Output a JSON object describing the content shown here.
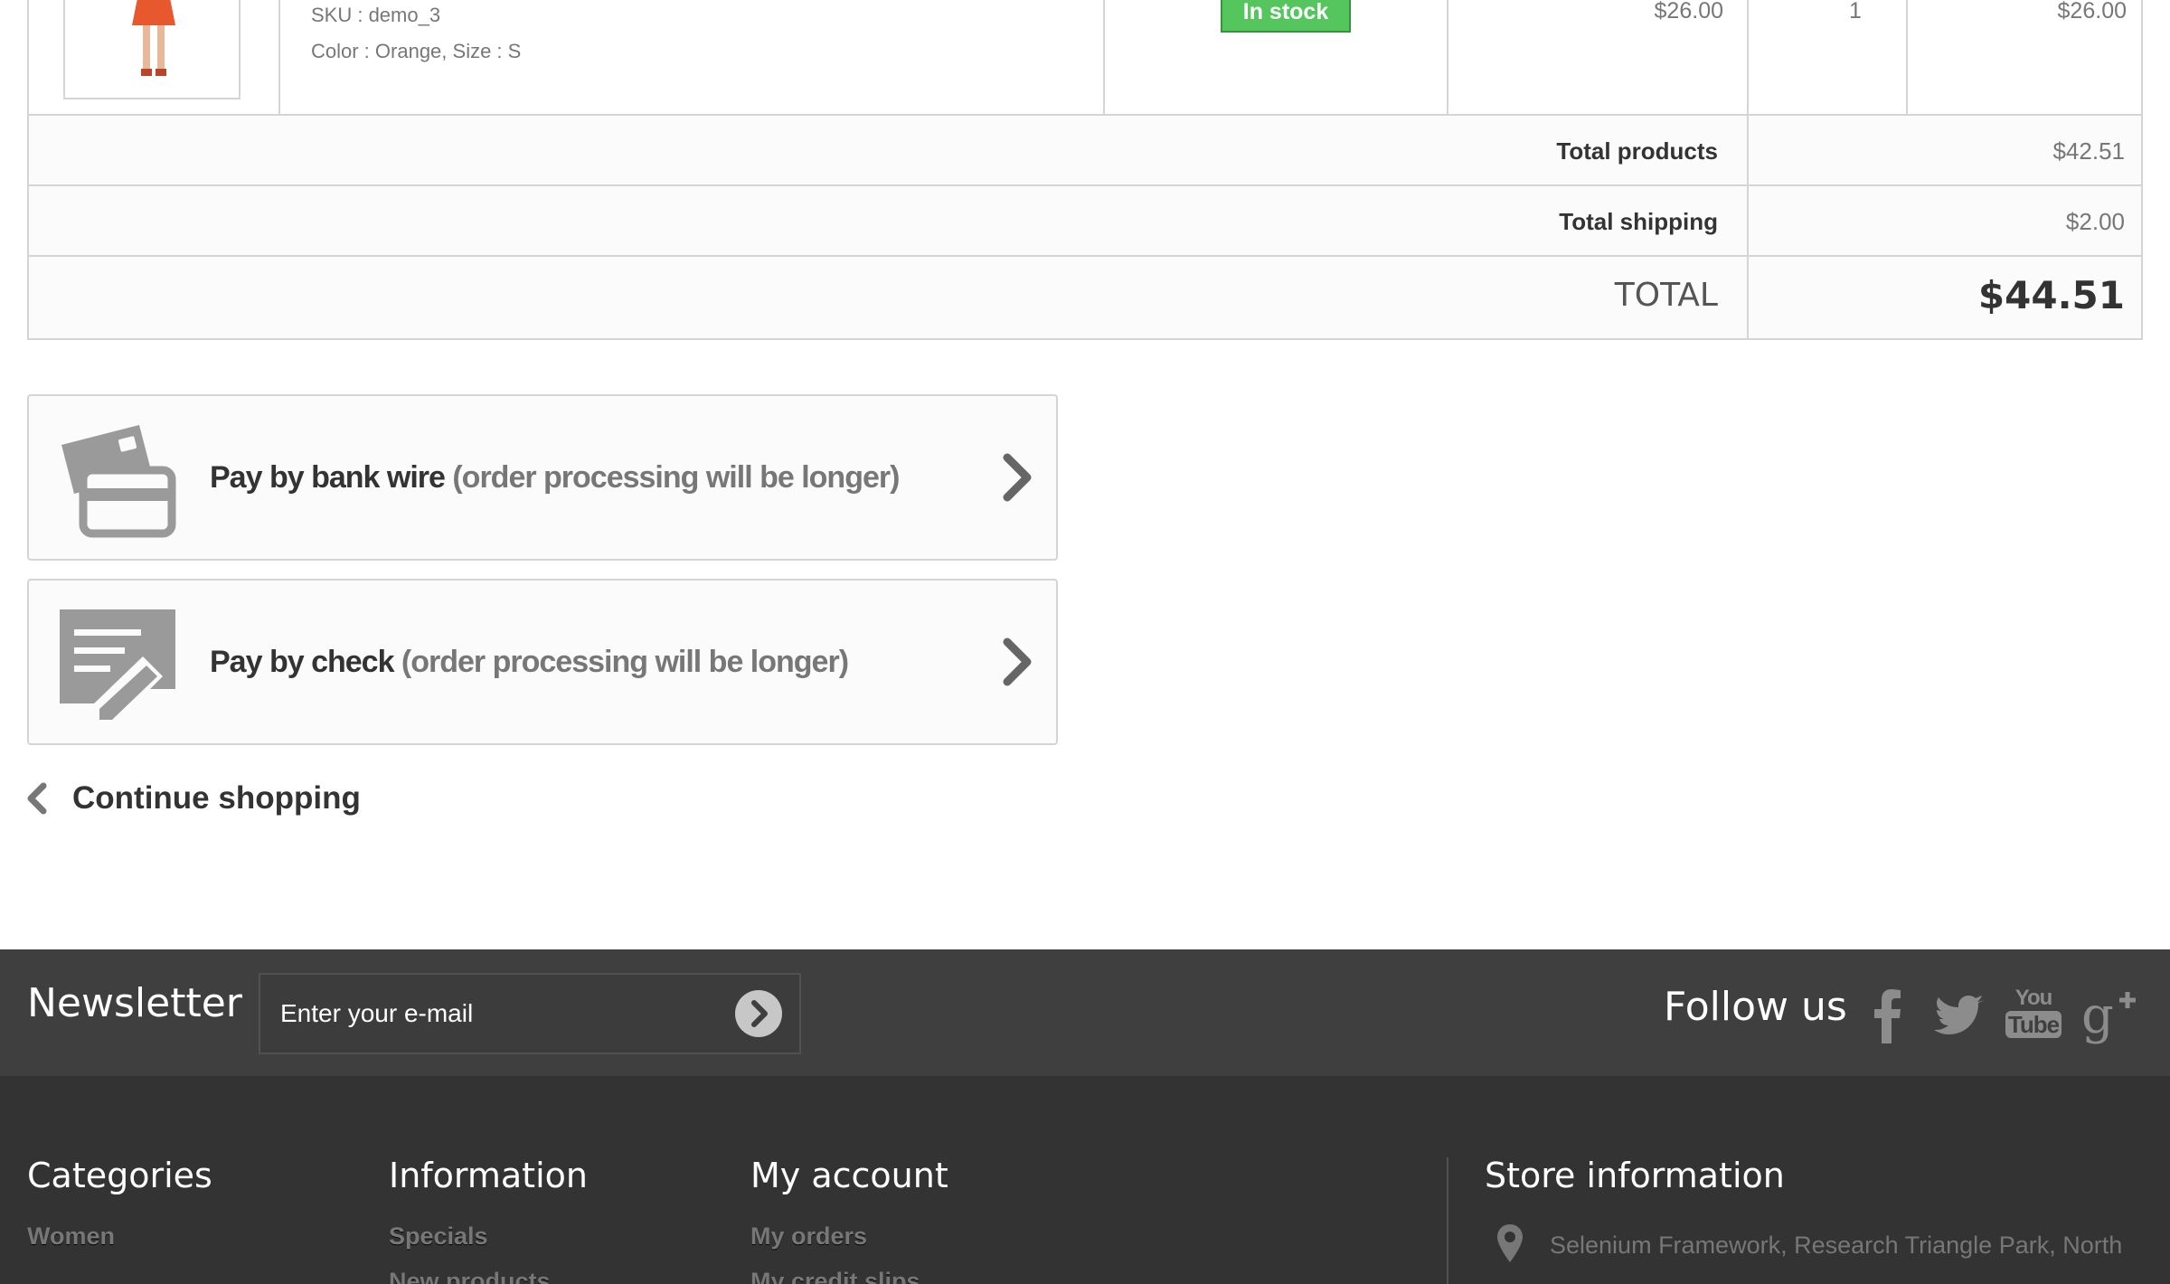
{
  "cart": {
    "product": {
      "sku": "SKU : demo_3",
      "attributes": "Color : Orange, Size : S",
      "availability": "In stock",
      "unit_price": "$26.00",
      "quantity": "1",
      "line_total": "$26.00"
    },
    "totals": {
      "products_label": "Total products",
      "products_value": "$42.51",
      "shipping_label": "Total shipping",
      "shipping_value": "$2.00",
      "grand_label": "TOTAL",
      "grand_value": "$44.51"
    }
  },
  "payment": {
    "bank_wire": {
      "title": "Pay by bank wire",
      "note": " (order processing will be longer)"
    },
    "check": {
      "title": "Pay by check",
      "note": " (order processing will be longer)"
    }
  },
  "continue_label": "Continue shopping",
  "newsletter": {
    "title": "Newsletter",
    "placeholder": "Enter your e-mail"
  },
  "follow": {
    "title": "Follow us",
    "networks": [
      "facebook-icon",
      "twitter-icon",
      "youtube-icon",
      "google-plus-icon"
    ],
    "youtube_you": "You",
    "youtube_tube": "Tube"
  },
  "footer": {
    "categories": {
      "title": "Categories",
      "links": [
        "Women"
      ]
    },
    "information": {
      "title": "Information",
      "links": [
        "Specials",
        "New products"
      ]
    },
    "my_account": {
      "title": "My account",
      "links": [
        "My orders",
        "My credit slips"
      ]
    },
    "store": {
      "title": "Store information",
      "address": "Selenium Framework, Research Triangle Park, North"
    }
  },
  "colors": {
    "stock_green": "#55c65e",
    "newsletter_bar": "#3f3f3f",
    "footer_bg": "#333333",
    "border": "#d6d4d4"
  }
}
